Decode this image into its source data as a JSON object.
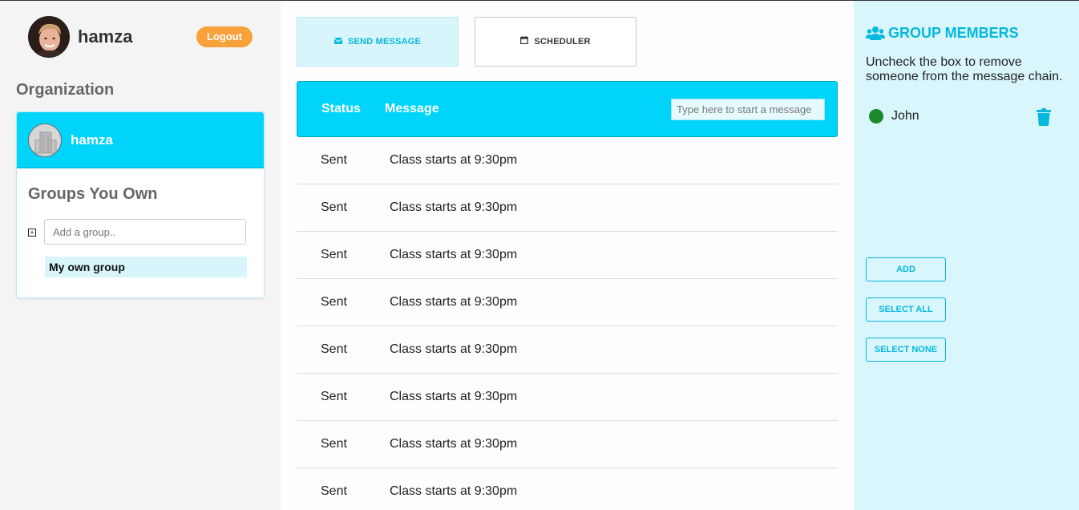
{
  "user": {
    "name": "hamza",
    "logout_label": "Logout"
  },
  "organization": {
    "section_title": "Organization",
    "name": "hamza",
    "groups_title": "Groups You Own",
    "add_group_placeholder": "Add a group..",
    "groups": [
      "My own group"
    ]
  },
  "tabs": [
    {
      "label": "SEND MESSAGE",
      "icon": "envelope-icon",
      "active": true
    },
    {
      "label": "SCHEDULER",
      "icon": "calendar-icon",
      "active": false
    }
  ],
  "messages": {
    "col_status": "Status",
    "col_message": "Message",
    "input_placeholder": "Type here to start a message",
    "rows": [
      {
        "status": "Sent",
        "text": "Class starts at 9:30pm"
      },
      {
        "status": "Sent",
        "text": "Class starts at 9:30pm"
      },
      {
        "status": "Sent",
        "text": "Class starts at 9:30pm"
      },
      {
        "status": "Sent",
        "text": "Class starts at 9:30pm"
      },
      {
        "status": "Sent",
        "text": "Class starts at 9:30pm"
      },
      {
        "status": "Sent",
        "text": "Class starts at 9:30pm"
      },
      {
        "status": "Sent",
        "text": "Class starts at 9:30pm"
      },
      {
        "status": "Sent",
        "text": "Class starts at 9:30pm"
      }
    ]
  },
  "group_members": {
    "title": "GROUP MEMBERS",
    "instructions": "Uncheck the box to remove someone from the message chain.",
    "members": [
      {
        "name": "John",
        "status_color": "#1a8a2c"
      }
    ],
    "add_label": "ADD",
    "select_all_label": "SELECT ALL",
    "select_none_label": "SELECT NONE"
  },
  "colors": {
    "accent": "#00d4fb",
    "accent_text": "#05b8dd",
    "logout": "#f9a13a",
    "panel_bg": "#d9f6fc"
  }
}
